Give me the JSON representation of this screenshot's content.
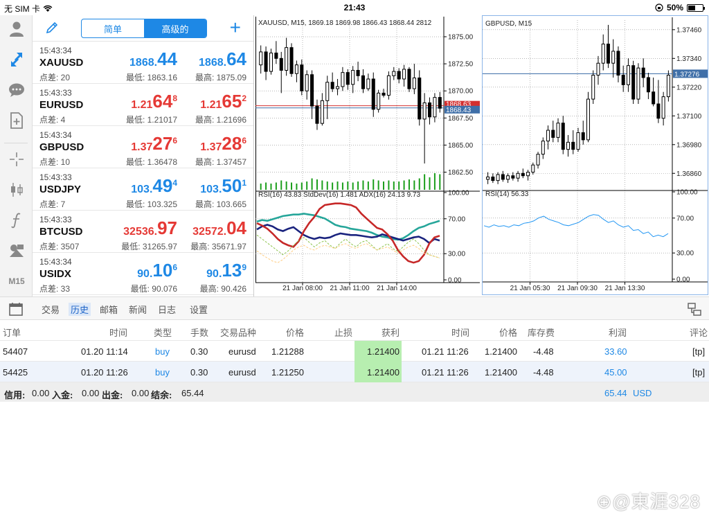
{
  "status": {
    "carrier": "无 SIM 卡",
    "time": "21:43",
    "battery": "50%",
    "battery_level": 0.5
  },
  "quotes_panel": {
    "segments": [
      "简单",
      "高级的"
    ],
    "selected_segment": 1,
    "rows": [
      {
        "time": "15:43:34",
        "symbol": "XAUUSD",
        "spread": "点差: 20",
        "low": "最低: 1863.16",
        "high": "最高: 1875.09",
        "bid": [
          "1868.",
          "44",
          ""
        ],
        "ask": [
          "1868.",
          "64",
          ""
        ],
        "bid_color": "#1e88e5",
        "ask_color": "#1e88e5"
      },
      {
        "time": "15:43:33",
        "symbol": "EURUSD",
        "spread": "点差: 4",
        "low": "最低: 1.21017",
        "high": "最高: 1.21696",
        "bid": [
          "1.21",
          "64",
          "8"
        ],
        "ask": [
          "1.21",
          "65",
          "2"
        ],
        "bid_color": "#e53935",
        "ask_color": "#e53935"
      },
      {
        "time": "15:43:34",
        "symbol": "GBPUSD",
        "spread": "点差: 10",
        "low": "最低: 1.36478",
        "high": "最高: 1.37457",
        "bid": [
          "1.37",
          "27",
          "6"
        ],
        "ask": [
          "1.37",
          "28",
          "6"
        ],
        "bid_color": "#e53935",
        "ask_color": "#e53935"
      },
      {
        "time": "15:43:33",
        "symbol": "USDJPY",
        "spread": "点差: 7",
        "low": "最低: 103.325",
        "high": "最高: 103.665",
        "bid": [
          "103.",
          "49",
          "4"
        ],
        "ask": [
          "103.",
          "50",
          "1"
        ],
        "bid_color": "#1e88e5",
        "ask_color": "#1e88e5"
      },
      {
        "time": "15:43:33",
        "symbol": "BTCUSD",
        "spread": "点差: 3507",
        "low": "最低: 31265.97",
        "high": "最高: 35671.97",
        "bid": [
          "32536.",
          "97",
          ""
        ],
        "ask": [
          "32572.",
          "04",
          ""
        ],
        "bid_color": "#e53935",
        "ask_color": "#e53935"
      },
      {
        "time": "15:43:34",
        "symbol": "USIDX",
        "spread": "点差: 33",
        "low": "最低: 90.076",
        "high": "最高: 90.426",
        "bid": [
          "90.",
          "10",
          "6"
        ],
        "ask": [
          "90.",
          "13",
          "9"
        ],
        "bid_color": "#1e88e5",
        "ask_color": "#1e88e5"
      }
    ]
  },
  "rail": {
    "timeframe": "M15"
  },
  "chart_data": [
    {
      "type": "candlestick",
      "title": "XAUUSD, M15, 1869.18 1869.98 1866.43 1868.44 2812",
      "y_ticks": [
        "1875.00",
        "1872.50",
        "1870.00",
        "1867.50",
        "1865.00",
        "1862.50"
      ],
      "y_tick_values": [
        1875,
        1872.5,
        1870,
        1867.5,
        1865,
        1862.5
      ],
      "ylim": [
        1861.0,
        1876.6
      ],
      "price_tags": [
        "1868.63",
        "1868.43"
      ],
      "candles": [
        [
          1872.4,
          1874.2,
          1871.6,
          1873.6
        ],
        [
          1873.6,
          1874.1,
          1871.0,
          1871.8
        ],
        [
          1871.8,
          1873.9,
          1871.5,
          1873.5
        ],
        [
          1873.5,
          1874.6,
          1872.5,
          1873.0
        ],
        [
          1873.0,
          1873.6,
          1869.8,
          1871.9
        ],
        [
          1871.9,
          1874.9,
          1871.4,
          1874.0
        ],
        [
          1874.0,
          1874.4,
          1871.3,
          1871.6
        ],
        [
          1871.6,
          1872.8,
          1870.8,
          1872.4
        ],
        [
          1872.4,
          1872.9,
          1869.6,
          1870.0
        ],
        [
          1870.0,
          1871.9,
          1869.2,
          1871.5
        ],
        [
          1871.5,
          1871.9,
          1867.4,
          1868.6
        ],
        [
          1868.6,
          1869.2,
          1866.4,
          1867.0
        ],
        [
          1867.0,
          1869.8,
          1866.8,
          1869.1
        ],
        [
          1869.1,
          1871.4,
          1867.4,
          1870.8
        ],
        [
          1870.8,
          1871.7,
          1869.9,
          1870.2
        ],
        [
          1870.2,
          1871.1,
          1869.6,
          1870.4
        ],
        [
          1870.4,
          1872.2,
          1870.0,
          1871.7
        ],
        [
          1871.7,
          1872.0,
          1870.1,
          1870.6
        ],
        [
          1870.6,
          1872.3,
          1869.8,
          1871.9
        ],
        [
          1871.9,
          1872.7,
          1870.9,
          1871.4
        ],
        [
          1871.4,
          1872.0,
          1869.8,
          1870.2
        ],
        [
          1870.2,
          1871.6,
          1870.0,
          1871.1
        ],
        [
          1871.1,
          1871.7,
          1867.6,
          1868.3
        ],
        [
          1868.3,
          1870.1,
          1868.0,
          1869.8
        ],
        [
          1869.8,
          1870.2,
          1869.4,
          1869.6
        ],
        [
          1869.6,
          1871.8,
          1869.2,
          1871.4
        ],
        [
          1871.4,
          1872.2,
          1871.0,
          1871.8
        ],
        [
          1871.8,
          1872.1,
          1870.7,
          1871.1
        ],
        [
          1871.1,
          1872.4,
          1870.4,
          1872.0
        ],
        [
          1872.0,
          1872.2,
          1869.9,
          1870.2
        ],
        [
          1870.2,
          1872.5,
          1869.7,
          1871.2
        ],
        [
          1871.2,
          1871.9,
          1866.8,
          1867.4
        ],
        [
          1867.4,
          1869.8,
          1863.3,
          1868.9
        ],
        [
          1868.9,
          1869.4,
          1866.9,
          1867.6
        ],
        [
          1867.6,
          1869.8,
          1867.1,
          1869.4
        ],
        [
          1869.4,
          1869.9,
          1868.0,
          1868.4
        ]
      ],
      "volumes": [
        0.3,
        0.35,
        0.3,
        0.35,
        0.45,
        0.4,
        0.35,
        0.3,
        0.35,
        0.4,
        0.55,
        0.5,
        0.45,
        0.4,
        0.35,
        0.4,
        0.35,
        0.4,
        0.35,
        0.4,
        0.45,
        0.4,
        0.5,
        0.45,
        0.4,
        0.45,
        0.4,
        0.4,
        0.45,
        0.5,
        0.45,
        0.55,
        0.75,
        0.6,
        0.8,
        0.75
      ],
      "indicator": {
        "title": "RSI(16) 43.83 StdDev(16) 1.481 ADX(16) 24.13 9.73",
        "y_ticks": [
          "100.00",
          "70.00",
          "30.00",
          "0.00"
        ],
        "y_tick_values": [
          100,
          70,
          30,
          0
        ],
        "ylim": [
          0,
          100
        ],
        "series": [
          {
            "color": "#26a69a",
            "values": [
              72,
              74,
              73,
              75,
              77,
              79,
              80,
              81,
              81,
              82,
              81,
              80,
              78,
              76,
              72,
              68,
              66,
              65,
              63,
              62,
              61,
              60,
              58,
              55,
              53,
              52,
              50,
              49,
              51,
              55,
              60,
              64,
              66,
              69,
              71,
              73
            ]
          },
          {
            "color": "#1a237e",
            "values": [
              62,
              66,
              68,
              66,
              62,
              60,
              63,
              65,
              60,
              55,
              52,
              50,
              52,
              51,
              52,
              55,
              57,
              56,
              55,
              55,
              54,
              53,
              52,
              53,
              56,
              54,
              52,
              50,
              48,
              50,
              52,
              53,
              50,
              45,
              50,
              48
            ]
          },
          {
            "color": "#c62828",
            "values": [
              70,
              67,
              63,
              57,
              50,
              45,
              42,
              40,
              47,
              60,
              70,
              78,
              88,
              93,
              94,
              95,
              95,
              94,
              93,
              90,
              82,
              76,
              70,
              64,
              62,
              56,
              48,
              36,
              28,
              22,
              20,
              22,
              30,
              44,
              52,
              54
            ]
          },
          {
            "color": "#8bc34a",
            "values": [
              55,
              50,
              45,
              40,
              35,
              30,
              35,
              42,
              48,
              52,
              46,
              40,
              45,
              48,
              42,
              38,
              45,
              50,
              44,
              40,
              46,
              48,
              42,
              36,
              40,
              44,
              38,
              34,
              40,
              46,
              50,
              44,
              36,
              30,
              28,
              26
            ],
            "dashed": true
          },
          {
            "color": "#ffcc80",
            "values": [
              35,
              30,
              26,
              22,
              20,
              24,
              30,
              36,
              40,
              42,
              38,
              36,
              40,
              42,
              40,
              38,
              42,
              44,
              40,
              38,
              42,
              44,
              40,
              36,
              38,
              40,
              36,
              32,
              36,
              40,
              42,
              38,
              32,
              30,
              28,
              26
            ],
            "dashed": true
          }
        ]
      },
      "x_ticks": [
        "21 Jan 08:00",
        "21 Jan 11:00",
        "21 Jan 14:00"
      ]
    },
    {
      "type": "candlestick",
      "title": "GBPUSD, M15",
      "y_ticks": [
        "1.37460",
        "1.37340",
        "1.37220",
        "1.37100",
        "1.36980",
        "1.36860"
      ],
      "y_tick_values": [
        1.3746,
        1.3734,
        1.3722,
        1.371,
        1.3698,
        1.3686
      ],
      "ylim": [
        1.368,
        1.375
      ],
      "price_tag": "1.37276",
      "price_tag_value": 1.37276,
      "candles": [
        [
          1.36835,
          1.36865,
          1.36815,
          1.36845
        ],
        [
          1.36845,
          1.3686,
          1.3682,
          1.3683
        ],
        [
          1.3683,
          1.36865,
          1.36815,
          1.36855
        ],
        [
          1.36855,
          1.3687,
          1.36825,
          1.36835
        ],
        [
          1.36835,
          1.3686,
          1.3682,
          1.3685
        ],
        [
          1.3685,
          1.36865,
          1.3683,
          1.3684
        ],
        [
          1.3684,
          1.3687,
          1.36825,
          1.3686
        ],
        [
          1.3686,
          1.3688,
          1.3684,
          1.3685
        ],
        [
          1.3685,
          1.36875,
          1.3683,
          1.36865
        ],
        [
          1.36865,
          1.36905,
          1.36855,
          1.36895
        ],
        [
          1.36895,
          1.3695,
          1.3688,
          1.3694
        ],
        [
          1.3694,
          1.3701,
          1.3692,
          1.36995
        ],
        [
          1.36995,
          1.3706,
          1.3696,
          1.3704
        ],
        [
          1.3704,
          1.3708,
          1.3699,
          1.3701
        ],
        [
          1.3701,
          1.3709,
          1.3699,
          1.3707
        ],
        [
          1.3707,
          1.371,
          1.3694,
          1.3696
        ],
        [
          1.3696,
          1.3702,
          1.3693,
          1.3699
        ],
        [
          1.3699,
          1.3704,
          1.3694,
          1.3696
        ],
        [
          1.3696,
          1.3705,
          1.3695,
          1.3703
        ],
        [
          1.3703,
          1.3708,
          1.3698,
          1.37
        ],
        [
          1.37,
          1.372,
          1.3699,
          1.3717
        ],
        [
          1.3717,
          1.3729,
          1.3715,
          1.3727
        ],
        [
          1.3727,
          1.3735,
          1.3723,
          1.3732
        ],
        [
          1.3732,
          1.3744,
          1.3729,
          1.374
        ],
        [
          1.374,
          1.3748,
          1.373,
          1.3732
        ],
        [
          1.3732,
          1.3742,
          1.3726,
          1.3737
        ],
        [
          1.3737,
          1.3739,
          1.3724,
          1.3727
        ],
        [
          1.3727,
          1.3731,
          1.372,
          1.3723
        ],
        [
          1.3723,
          1.3734,
          1.372,
          1.3731
        ],
        [
          1.3731,
          1.3733,
          1.3715,
          1.3717
        ],
        [
          1.3717,
          1.3732,
          1.3715,
          1.373
        ],
        [
          1.373,
          1.3734,
          1.3722,
          1.3726
        ],
        [
          1.3726,
          1.3728,
          1.3717,
          1.372
        ],
        [
          1.372,
          1.3726,
          1.3714,
          1.3715
        ],
        [
          1.3715,
          1.3725,
          1.3707,
          1.3709
        ],
        [
          1.3709,
          1.372,
          1.3706,
          1.3718
        ],
        [
          1.3718,
          1.3729,
          1.3716,
          1.3727
        ]
      ],
      "indicator": {
        "title": "RSI(14) 56.33",
        "y_ticks": [
          "100.00",
          "70.00",
          "30.00",
          "0.00"
        ],
        "y_tick_values": [
          100,
          70,
          30,
          0
        ],
        "ylim": [
          0,
          100
        ],
        "series": [
          {
            "color": "#2196f3",
            "values": [
              66,
              64,
              67,
              65,
              66,
              64,
              67,
              66,
              69,
              70,
              72,
              76,
              78,
              74,
              72,
              70,
              67,
              66,
              68,
              70,
              74,
              78,
              80,
              79,
              74,
              70,
              72,
              67,
              64,
              66,
              60,
              61,
              56,
              58,
              52,
              54,
              52,
              56
            ]
          }
        ]
      },
      "x_ticks": [
        "21 Jan 05:30",
        "21 Jan 09:30",
        "21 Jan 13:30"
      ]
    }
  ],
  "toolbar": {
    "tabs": [
      "交易",
      "历史",
      "邮箱",
      "新闻",
      "日志",
      "设置"
    ],
    "selected": 1
  },
  "history": {
    "headers": [
      "订单",
      "时间",
      "类型",
      "手数",
      "交易品种",
      "价格",
      "止损",
      "获利",
      "时间",
      "价格",
      "库存费",
      "利润",
      "评论"
    ],
    "rows": [
      {
        "order": "54407",
        "open_time": "01.20 11:14",
        "type": "buy",
        "lots": "0.30",
        "symbol": "eurusd",
        "open_price": "1.21288",
        "sl": "",
        "tp": "1.21400",
        "close_time": "01.21 11:26",
        "close_price": "1.21400",
        "swap": "-4.48",
        "profit": "33.60",
        "comment": "[tp]"
      },
      {
        "order": "54425",
        "open_time": "01.20 11:26",
        "type": "buy",
        "lots": "0.30",
        "symbol": "eurusd",
        "open_price": "1.21250",
        "sl": "",
        "tp": "1.21400",
        "close_time": "01.21 11:26",
        "close_price": "1.21400",
        "swap": "-4.48",
        "profit": "45.00",
        "comment": "[tp]"
      }
    ],
    "footer": {
      "credit_label": "信用:",
      "credit": "0.00",
      "deposit_label": "入金:",
      "deposit": "0.00",
      "withdraw_label": "出金:",
      "withdraw": "0.00",
      "balance_label": "结余:",
      "balance": "65.44",
      "total_profit": "65.44",
      "currency": "USD"
    }
  },
  "watermark": "⊕@東涯328"
}
